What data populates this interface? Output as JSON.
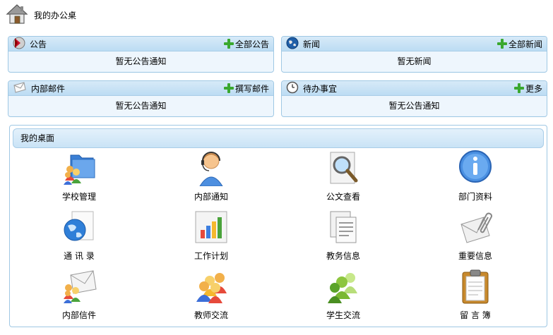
{
  "header": {
    "title": "我的办公桌"
  },
  "panels": [
    {
      "title": "公告",
      "more": "全部公告",
      "body": "暂无公告通知"
    },
    {
      "title": "新闻",
      "more": "全部新闻",
      "body": "暂无新闻"
    },
    {
      "title": "内部邮件",
      "more": "撰写邮件",
      "body": "暂无公告通知"
    },
    {
      "title": "待办事宜",
      "more": "更多",
      "body": "暂无公告通知"
    }
  ],
  "desk": {
    "title": "我的桌面",
    "items": [
      {
        "label": "学校管理",
        "icon": "people-folder-icon"
      },
      {
        "label": "内部通知",
        "icon": "operator-icon"
      },
      {
        "label": "公文查看",
        "icon": "magnifier-icon"
      },
      {
        "label": "部门资料",
        "icon": "info-icon"
      },
      {
        "label": "通 讯 录",
        "icon": "globe-document-icon"
      },
      {
        "label": "工作计划",
        "icon": "bar-chart-icon"
      },
      {
        "label": "教务信息",
        "icon": "documents-icon"
      },
      {
        "label": "重要信息",
        "icon": "paperclip-envelope-icon"
      },
      {
        "label": "内部信件",
        "icon": "people-envelope-icon"
      },
      {
        "label": "教师交流",
        "icon": "people-group-icon"
      },
      {
        "label": "学生交流",
        "icon": "green-people-icon"
      },
      {
        "label": "留 言 簿",
        "icon": "clipboard-icon"
      }
    ]
  }
}
